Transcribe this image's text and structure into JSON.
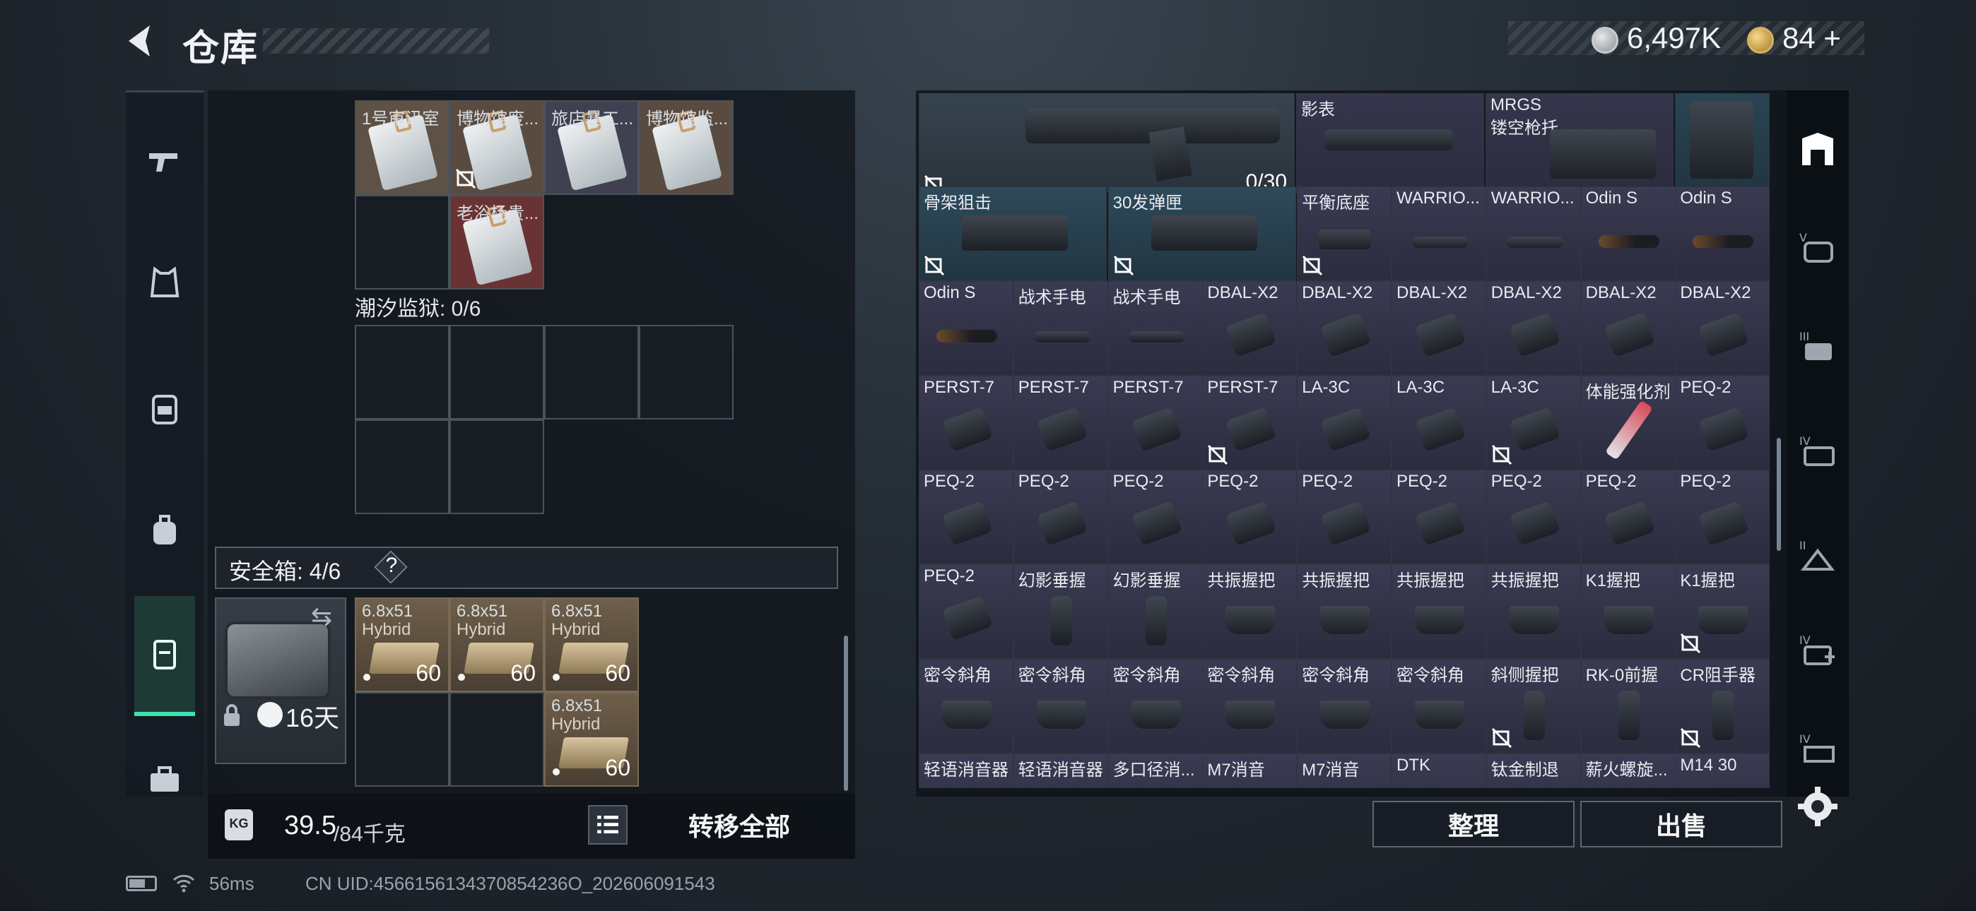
{
  "header": {
    "title": "仓库"
  },
  "currency": {
    "silver_amount": "6,497K",
    "gold_amount": "84",
    "gold_plus": "+"
  },
  "left_nav": {
    "items": [
      "weapon",
      "armor",
      "chest-rig",
      "backpack",
      "container",
      "toolbox"
    ]
  },
  "storage": {
    "doc_cells": [
      "1号审讯室",
      "博物馆废...",
      "旅店暴工...",
      "博物馆监...",
      "老浴杨贵..."
    ],
    "prison_label": "潮汐监狱: 0/6",
    "safebox_label": "安全箱: 4/6",
    "safebox_help": "?",
    "case_days": "16天",
    "ammo": [
      {
        "name": "6.8x51",
        "sub": "Hybrid",
        "qty": "60"
      },
      {
        "name": "6.8x51",
        "sub": "Hybrid",
        "qty": "60"
      },
      {
        "name": "6.8x51",
        "sub": "Hybrid",
        "qty": "60"
      },
      {
        "name": "6.8x51",
        "sub": "Hybrid",
        "qty": "60"
      }
    ],
    "weight_current": "39.5",
    "weight_max": "/84千克",
    "weight_icon": "KG",
    "transfer_all": "转移全部"
  },
  "inventory": {
    "top_row": [
      {
        "label": "",
        "qty": "0/30"
      },
      {
        "label": "影表"
      },
      {
        "label": "MRGS",
        "sub": "镂空枪托"
      },
      {
        "label": ""
      }
    ],
    "row1": [
      "骨架狙击",
      "30发弹匣",
      "平衡底座",
      "WARRIO...",
      "WARRIO...",
      "Odin S",
      "Odin S"
    ],
    "row2": [
      "Odin S",
      "战术手电",
      "战术手电",
      "DBAL-X2",
      "DBAL-X2",
      "DBAL-X2",
      "DBAL-X2",
      "DBAL-X2",
      "DBAL-X2"
    ],
    "row3": [
      "PERST-7",
      "PERST-7",
      "PERST-7",
      "PERST-7",
      "LA-3C",
      "LA-3C",
      "LA-3C",
      "体能强化剂",
      "PEQ-2"
    ],
    "row4": [
      "PEQ-2",
      "PEQ-2",
      "PEQ-2",
      "PEQ-2",
      "PEQ-2",
      "PEQ-2",
      "PEQ-2",
      "PEQ-2",
      "PEQ-2"
    ],
    "row5": [
      "PEQ-2",
      "幻影垂握",
      "幻影垂握",
      "共振握把",
      "共振握把",
      "共振握把",
      "共振握把",
      "K1握把",
      "K1握把"
    ],
    "row6": [
      "密令斜角",
      "密令斜角",
      "密令斜角",
      "密令斜角",
      "密令斜角",
      "密令斜角",
      "斜侧握把",
      "RK-0前握",
      "CR阻手器"
    ],
    "row7": [
      "轻语消音器",
      "轻语消音器",
      "多口径消...",
      "M7消音",
      "M7消音",
      "DTK",
      "钛金制退",
      "薪火螺旋...",
      "M14 30"
    ],
    "sort_label": "整理",
    "sell_label": "出售"
  },
  "right_tabs": [
    "stash-tab",
    "tier-v-tab",
    "tier-iii-tab",
    "tier-iv-tab",
    "tier-ii-tab",
    "tier-iv-medical-tab",
    "tier-iv-folder-tab"
  ],
  "status": {
    "ping": "56ms",
    "uid": "CN UID:4566156134370854236O_202606091543"
  },
  "colors": {
    "accent": "#3ee0b0",
    "item_bg": "#33344a",
    "item_blue_bg": "#2e4a5a",
    "doc_bg": "#6b5a4a",
    "doc_red_bg": "#6e3434",
    "ammo_bg": "#6f5f4a"
  }
}
